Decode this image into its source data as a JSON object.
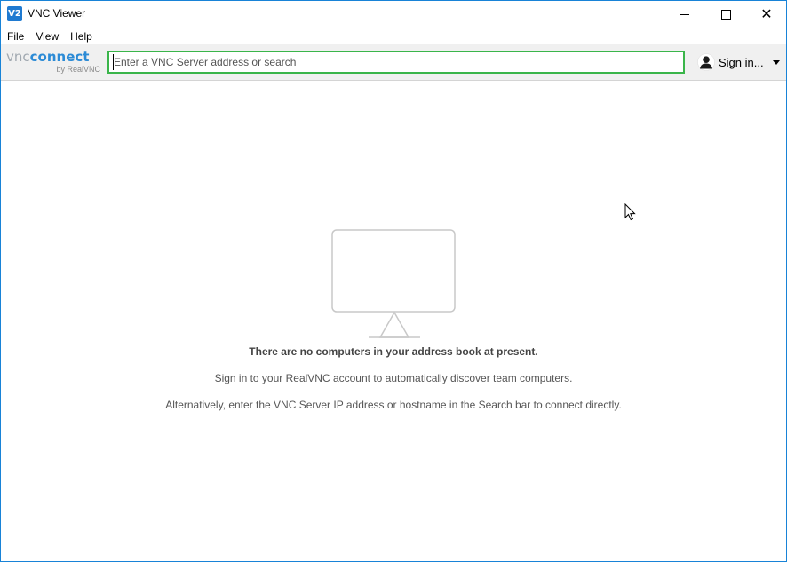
{
  "window": {
    "title": "VNC Viewer",
    "icon_text": "V2",
    "controls": {
      "minimize_icon": "minimize-icon",
      "maximize_icon": "maximize-icon",
      "close_glyph": "✕"
    }
  },
  "menu": {
    "items": [
      "File",
      "View",
      "Help"
    ]
  },
  "toolbar": {
    "logo": {
      "vnc": "vnc",
      "connect": "connect",
      "by": "by RealVNC"
    },
    "search": {
      "placeholder": "Enter a VNC Server address or search",
      "value": "",
      "focus_border_color": "#3ab54a"
    },
    "signin": {
      "label": "Sign in...",
      "icon": "user-avatar-icon",
      "caret_icon": "caret-down-icon"
    }
  },
  "main": {
    "empty_icon": "monitor-icon",
    "title": "There are no computers in your address book at present.",
    "line1": "Sign in to your RealVNC account to automatically discover team computers.",
    "line2": "Alternatively, enter the VNC Server IP address or hostname in the Search bar to connect directly."
  },
  "colors": {
    "accent": "#1f7ad1",
    "logo_blue": "#2c8bd6",
    "logo_gray": "#a0a8b0",
    "window_border": "#1883d7"
  }
}
